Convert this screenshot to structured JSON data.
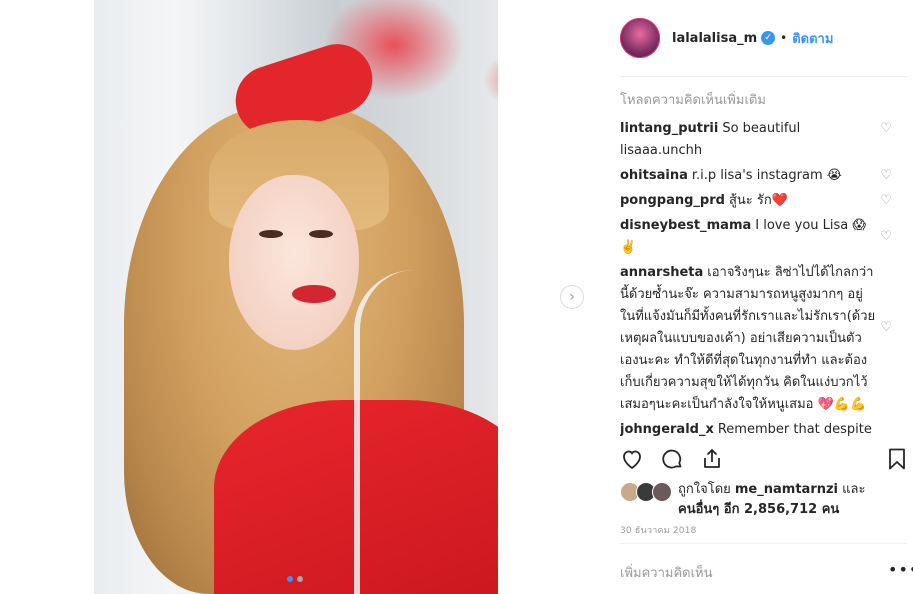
{
  "post": {
    "username": "lalalalisa_m",
    "follow_label": "ติดตาม",
    "separator": "•",
    "load_more": "โหลดความคิดเห็นเพิ่มเติม",
    "carousel": {
      "current": 1,
      "total": 2
    },
    "comments": [
      {
        "user": "lintang_putrii",
        "text": "So beautiful lisaaa.unchh"
      },
      {
        "user": "ohitsaina",
        "text": "r.i.p lisa's instagram 😭"
      },
      {
        "user": "pongpang_prd",
        "text": "สู้นะ รัก❤️"
      },
      {
        "user": "disneybest_mama",
        "text": "I love you Lisa 😱✌️"
      },
      {
        "user": "annarsheta",
        "text": "เอาจริงๆนะ ลิซ่าไปได้ไกลกว่านี้ด้วยซ้ำนะจ๊ะ ความสามารถหนูสูงมากๆ อยู่ในที่แจ้งมันก็มีทั้งคนที่รักเราและไม่รักเรา(ด้วยเหตุผลในแบบของเค้า) อย่าเสียความเป็นตัวเองนะคะ ทำให้ดีที่สุดในทุกงานที่ทำ และต้องเก็บเกี่ยวความสุขให้ได้ทุกวัน คิดในแง่บวกไว้เสมอๆนะคะเป็นกำลังใจให้หนูเสมอ 💖💪💪"
      },
      {
        "user": "johngerald_x",
        "text": "Remember that despite the bad comments, there are still millions of us who will love and"
      }
    ],
    "likes": {
      "prefix": "ถูกใจโดย",
      "user": "me_namtarnzi",
      "and": "และ",
      "others_prefix": "คนอื่นๆ อีก",
      "count": "2,856,712",
      "suffix": "คน"
    },
    "date": "30 ธันวาคม 2018",
    "add_comment_placeholder": "เพิ่มความคิดเห็น",
    "more_options": "•••"
  },
  "icons": {
    "like": "heart-icon",
    "comment": "comment-icon",
    "share": "share-icon",
    "save": "bookmark-icon",
    "verified": "verified-badge-icon",
    "next": "chevron-right-icon"
  },
  "colors": {
    "accent": "#3897f0",
    "muted": "#999999",
    "text": "#262626"
  }
}
